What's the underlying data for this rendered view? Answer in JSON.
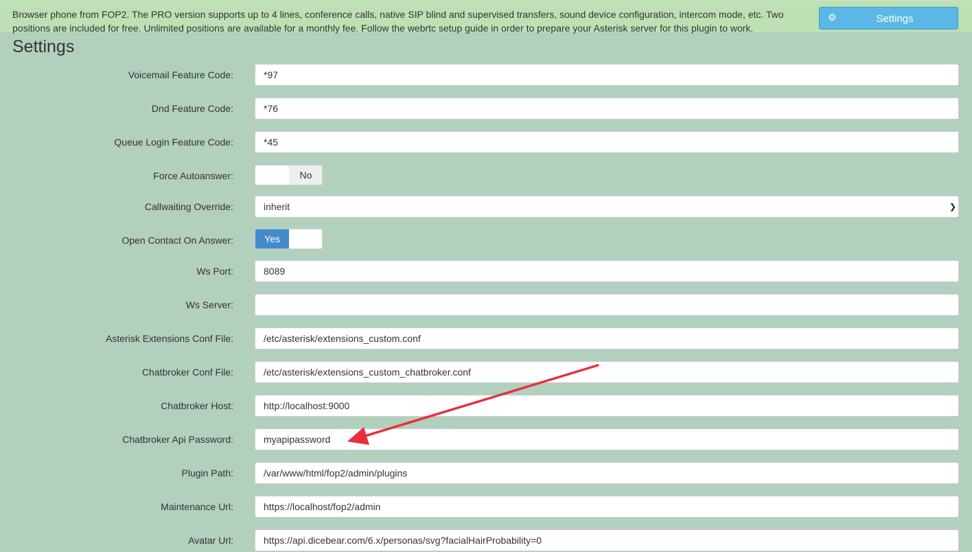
{
  "header": {
    "description": "Browser phone from FOP2. The PRO version supports up to 4 lines, conference calls, native SIP blind and supervised transfers, sound device configuration, intercom mode, etc. Two positions are included for free. Unlimited positions are available for a monthly fee. Follow the webrtc setup guide in order to prepare your Asterisk server for this plugin to work.",
    "settings_button": "Settings",
    "settings_icon": "gear-icon"
  },
  "page_title": "Settings",
  "fields": {
    "voicemail": {
      "label": "Voicemail Feature Code:",
      "value": "*97"
    },
    "dnd": {
      "label": "Dnd Feature Code:",
      "value": "*76"
    },
    "queue_login": {
      "label": "Queue Login Feature Code:",
      "value": "*45"
    },
    "force_autoanswer": {
      "label": "Force Autoanswer:",
      "state": "No"
    },
    "callwaiting": {
      "label": "Callwaiting Override:",
      "value": "inherit"
    },
    "open_contact": {
      "label": "Open Contact On Answer:",
      "state": "Yes"
    },
    "ws_port": {
      "label": "Ws Port:",
      "value": "8089"
    },
    "ws_server": {
      "label": "Ws Server:",
      "value": ""
    },
    "ext_conf": {
      "label": "Asterisk Extensions Conf File:",
      "value": "/etc/asterisk/extensions_custom.conf"
    },
    "chatbroker_conf": {
      "label": "Chatbroker Conf File:",
      "value": "/etc/asterisk/extensions_custom_chatbroker.conf"
    },
    "chatbroker_host": {
      "label": "Chatbroker Host:",
      "value": "http://localhost:9000"
    },
    "chatbroker_api": {
      "label": "Chatbroker Api Password:",
      "value": "myapipassword"
    },
    "plugin_path": {
      "label": "Plugin Path:",
      "value": "/var/www/html/fop2/admin/plugins"
    },
    "maintenance_url": {
      "label": "Maintenance Url:",
      "value": "https://localhost/fop2/admin"
    },
    "avatar_url": {
      "label": "Avatar Url:",
      "value": "https://api.dicebear.com/6.x/personas/svg?facialHairProbability=0"
    }
  },
  "colors": {
    "background": "#b2d0be",
    "header_bg": "#bde0b4",
    "button": "#5bb7e6",
    "toggle_on": "#428bca",
    "annotation_arrow": "#e8303a"
  }
}
